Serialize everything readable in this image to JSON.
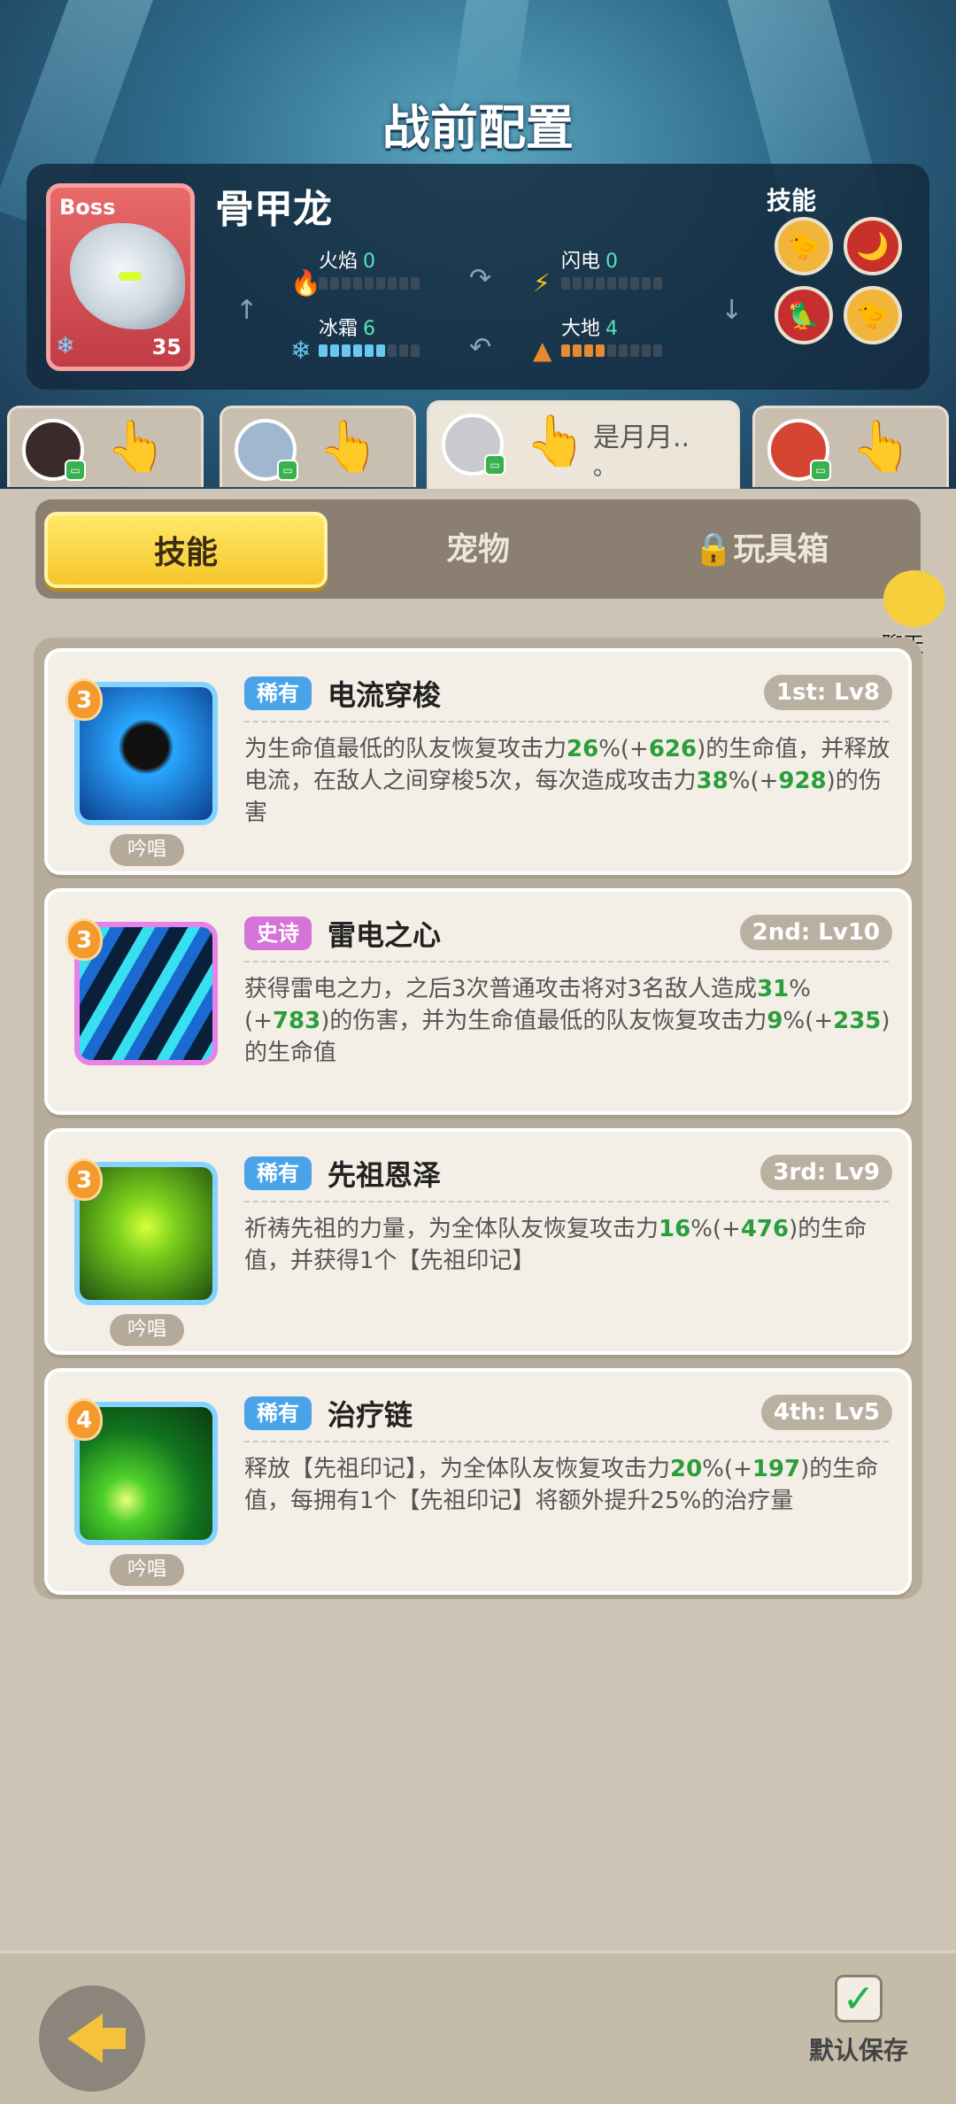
{
  "header": {
    "title": "战前配置"
  },
  "boss": {
    "tag": "Boss",
    "name": "骨甲龙",
    "level": "35",
    "elements": [
      {
        "name": "火焰",
        "value": "0",
        "icon": "fire-icon",
        "color": "#e0453b"
      },
      {
        "name": "闪电",
        "value": "0",
        "icon": "lightning-icon",
        "color": "#f2c318"
      },
      {
        "name": "冰霜",
        "value": "6",
        "icon": "frost-icon",
        "color": "#68c8f0"
      },
      {
        "name": "大地",
        "value": "4",
        "icon": "earth-icon",
        "color": "#e58a2f"
      }
    ],
    "skills_label": "技能",
    "skill_badges": [
      "6",
      "6"
    ]
  },
  "heroes": [
    {
      "name": "",
      "icon": "hero-avatar"
    },
    {
      "name": "",
      "icon": "hero-avatar"
    },
    {
      "name": "是月月..",
      "name2": "。",
      "icon": "hero-avatar"
    },
    {
      "name": "",
      "icon": "hero-avatar"
    }
  ],
  "tabs": {
    "skills": "技能",
    "pets": "宠物",
    "toybox": "玩具箱"
  },
  "chat": {
    "label": "聊天"
  },
  "skills": [
    {
      "cost": "3",
      "rarity": "稀有",
      "name": "电流穿梭",
      "slot": "1st: Lv8",
      "chant": "吟唱",
      "d1": "为生命值最低的队友恢复攻击力",
      "v1": "26",
      "p1": "%(+",
      "v2": "626",
      "d2": ")的生命值，并释放电流，在敌人之间穿梭5次，每次造成攻击力",
      "v3": "38",
      "p3": "%(+",
      "v4": "928",
      "d4": ")的伤害"
    },
    {
      "cost": "3",
      "rarity": "史诗",
      "name": "雷电之心",
      "slot": "2nd: Lv10",
      "chant": "",
      "d1": "获得雷电之力，之后3次普通攻击将对3名敌人造成",
      "v1": "31",
      "p1": "%(+",
      "v2": "783",
      "d2": ")的伤害，并为生命值最低的队友恢复攻击力",
      "v3": "9",
      "p3": "%(+",
      "v4": "235",
      "d4": ")的生命值"
    },
    {
      "cost": "3",
      "rarity": "稀有",
      "name": "先祖恩泽",
      "slot": "3rd: Lv9",
      "chant": "吟唱",
      "d1": "祈祷先祖的力量，为全体队友恢复攻击力",
      "v1": "16",
      "p1": "%(+",
      "v2": "476",
      "d2": ")的生命值，并获得1个【先祖印记】",
      "v3": "",
      "p3": "",
      "v4": "",
      "d4": ""
    },
    {
      "cost": "4",
      "rarity": "稀有",
      "name": "治疗链",
      "slot": "4th: Lv5",
      "chant": "吟唱",
      "d1": "释放【先祖印记】，为全体队友恢复攻击力",
      "v1": "20",
      "p1": "%(+",
      "v2": "197",
      "d2": ")的生命值，每拥有1个【先祖印记】将额外提升25%的治疗量",
      "v3": "",
      "p3": "",
      "v4": "",
      "d4": ""
    }
  ],
  "bottom": {
    "save_label": "默认保存"
  }
}
